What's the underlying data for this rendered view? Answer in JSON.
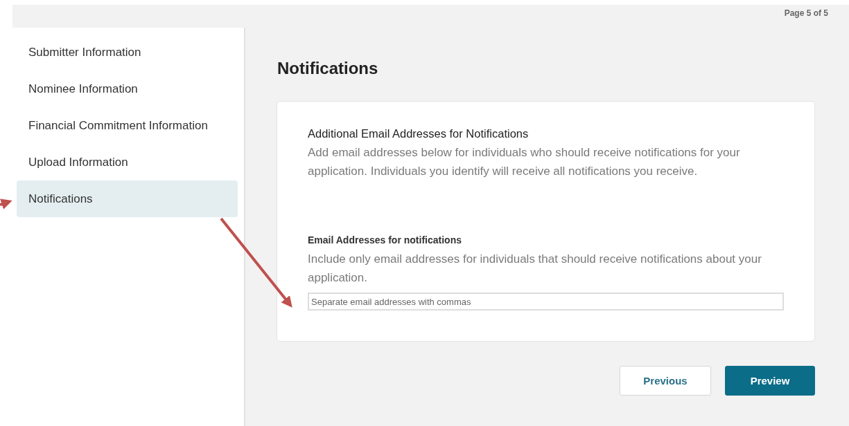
{
  "pager": "Page 5 of 5",
  "sidebar": {
    "items": [
      {
        "label": "Submitter Information",
        "selected": false
      },
      {
        "label": "Nominee Information",
        "selected": false
      },
      {
        "label": "Financial Commitment Information",
        "selected": false
      },
      {
        "label": "Upload Information",
        "selected": false
      },
      {
        "label": "Notifications",
        "selected": true
      }
    ]
  },
  "heading": "Notifications",
  "card": {
    "title": "Additional Email Addresses for Notifications",
    "description": "Add email addresses below for individuals who should receive notifications for your application. Individuals you identify will receive all notifications you receive.",
    "field": {
      "label": "Email Addresses for notifications",
      "help": "Include only email addresses for individuals that should receive notifications about your application.",
      "placeholder": "Separate email addresses with commas"
    }
  },
  "buttons": [
    {
      "label": "Previous",
      "kind": "secondary"
    },
    {
      "label": "Preview",
      "kind": "primary"
    }
  ]
}
